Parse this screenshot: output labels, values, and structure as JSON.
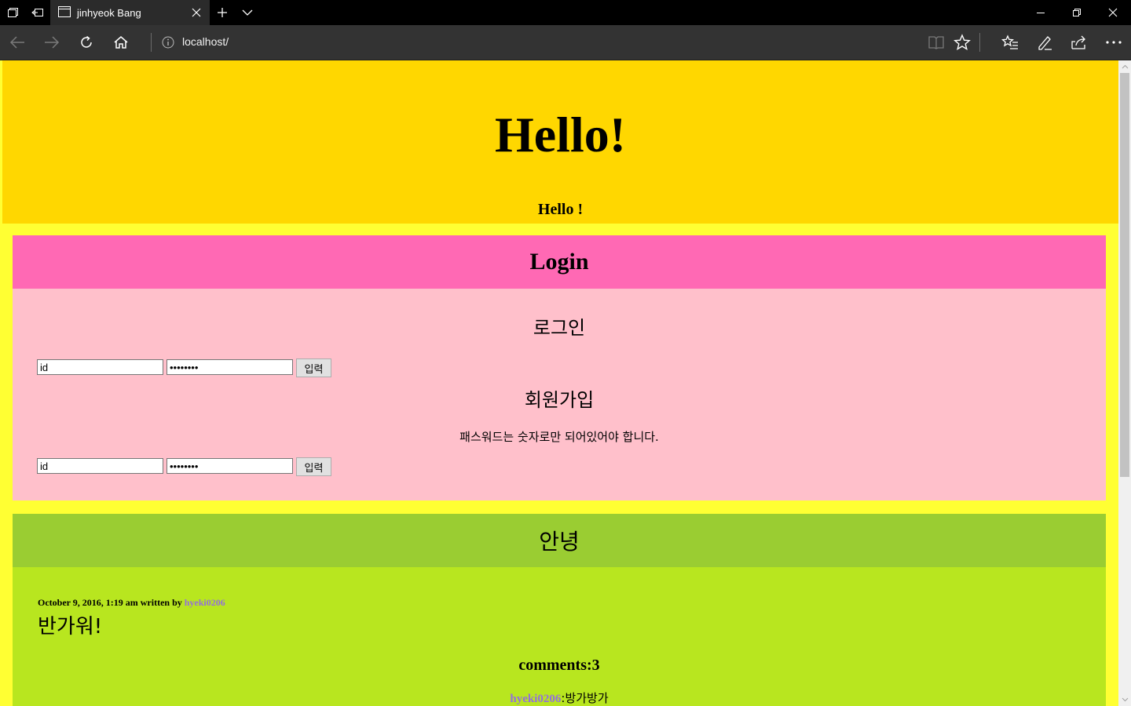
{
  "browser": {
    "tab_title": "jinhyeok Bang",
    "url": "localhost/"
  },
  "header": {
    "title": "Hello!",
    "subtitle": "Hello !"
  },
  "login_section": {
    "heading": "Login",
    "login_title": "로그인",
    "login_form": {
      "id_value": "id",
      "password_value": "password",
      "submit_label": "입력"
    },
    "signup_title": "회원가입",
    "password_note": "패스워드는 숫자로만 되어있어야 합니다.",
    "signup_form": {
      "id_value": "id",
      "password_value": "password",
      "submit_label": "입력"
    }
  },
  "greeting_section": {
    "heading": "안녕",
    "post": {
      "meta_prefix": "October 9, 2016, 1:19 am written by ",
      "author": "hyeki0206",
      "text": "반가워!"
    },
    "comments_label": "comments:3",
    "comments": [
      {
        "author": "hyeki0206",
        "separator": ":",
        "text": "방가방가"
      }
    ]
  },
  "colors": {
    "page_bg": "#ffff33",
    "header_bg": "#ffd700",
    "login_head_bg": "#ff69b4",
    "login_body_bg": "#ffc0cb",
    "greet_head_bg": "#9acd32",
    "greet_body_bg": "#b8e61f",
    "author_link": "#9370db"
  }
}
